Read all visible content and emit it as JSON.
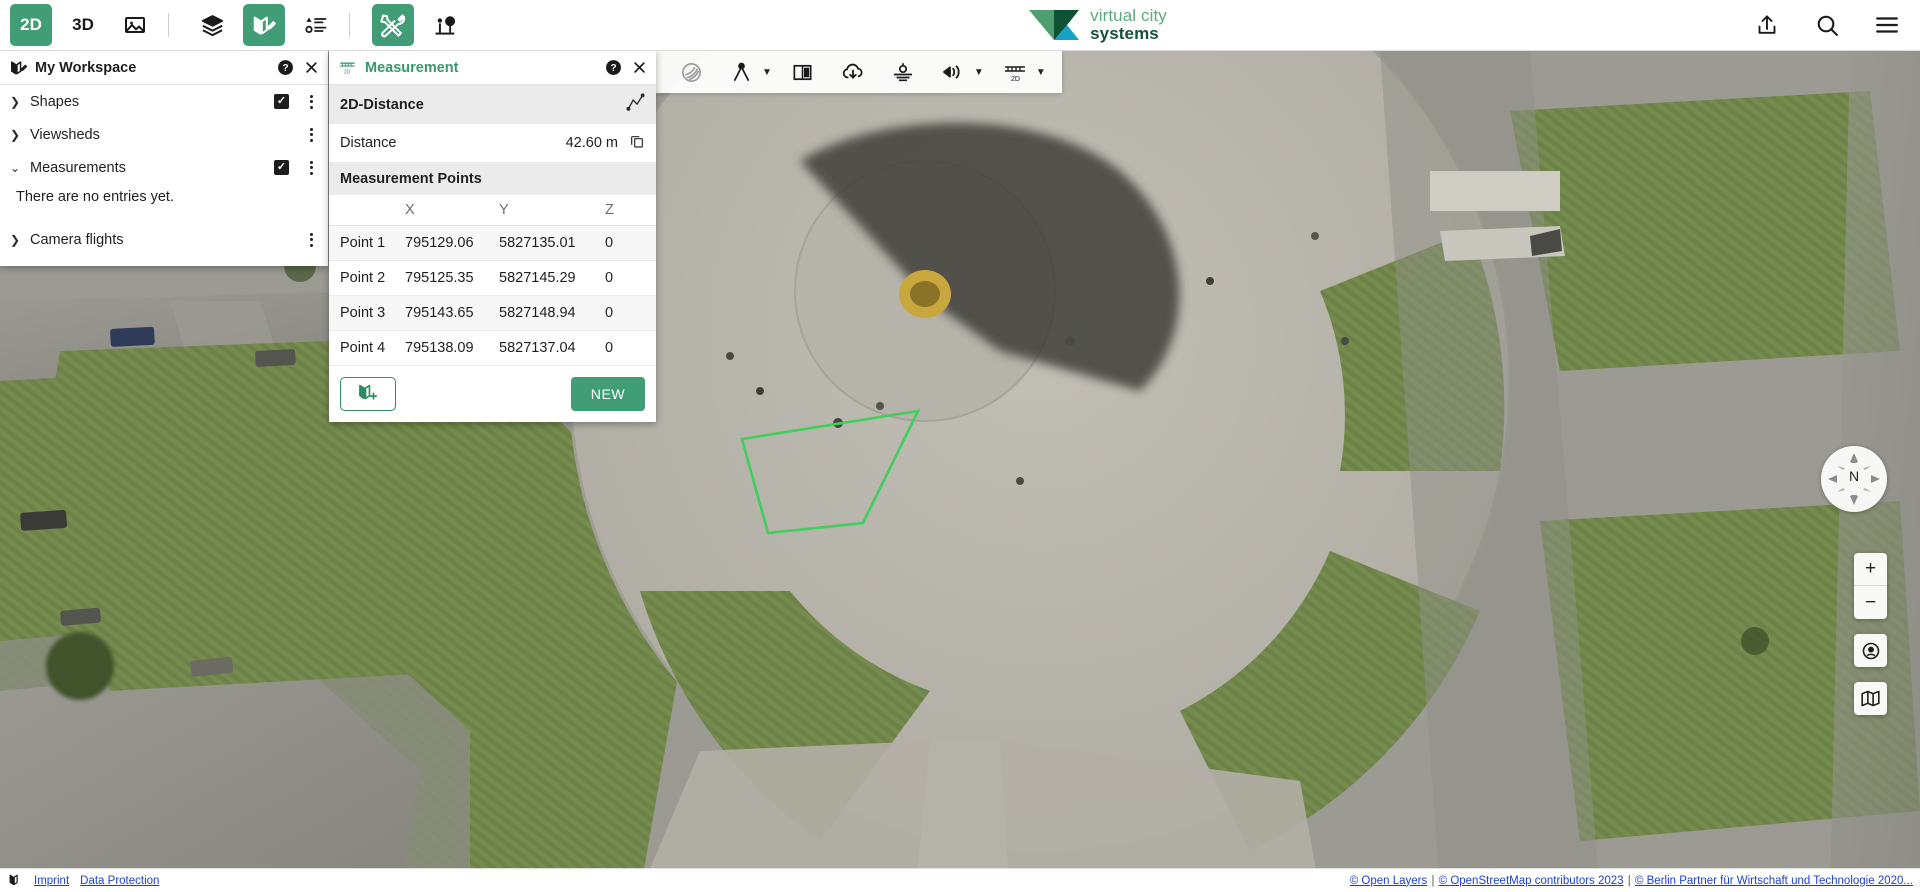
{
  "topbar": {
    "mode_2d": "2D",
    "mode_3d": "3D",
    "icons": {
      "image": "image-icon",
      "layers": "layers-icon",
      "workspace": "workspace-map-icon",
      "legend": "legend-icon",
      "tools": "tools-icon",
      "plantings": "tree-person-icon",
      "share": "share-icon",
      "search": "search-icon",
      "menu": "hamburger-menu-icon"
    },
    "logo": {
      "line1": "virtual city",
      "line2": "systems"
    }
  },
  "workspace": {
    "title": "My Workspace",
    "help_icon": "help-icon",
    "close_icon": "close-icon",
    "items": [
      {
        "label": "Shapes",
        "expanded": false,
        "checked": true
      },
      {
        "label": "Viewsheds",
        "expanded": false,
        "checked": false
      },
      {
        "label": "Measurements",
        "expanded": true,
        "checked": true
      }
    ],
    "empty_text": "There are no entries yet.",
    "camera_flights": {
      "label": "Camera flights",
      "expanded": false,
      "checked": false
    }
  },
  "measurement": {
    "title": "Measurement",
    "title_icon": "ruler-2d-icon",
    "help_icon": "help-icon",
    "close_icon": "close-icon",
    "section_mode": "2D-Distance",
    "mode_icon": "polyline-icon",
    "distance_label": "Distance",
    "distance_value": "42.60 m",
    "copy_icon": "copy-icon",
    "points_header": "Measurement Points",
    "columns": [
      "",
      "X",
      "Y",
      "Z"
    ],
    "points": [
      {
        "name": "Point 1",
        "x": "795129.06",
        "y": "5827135.01",
        "z": "0"
      },
      {
        "name": "Point 2",
        "x": "795125.35",
        "y": "5827145.29",
        "z": "0"
      },
      {
        "name": "Point 3",
        "x": "795143.65",
        "y": "5827148.94",
        "z": "0"
      },
      {
        "name": "Point 4",
        "x": "795138.09",
        "y": "5827137.04",
        "z": "0"
      }
    ],
    "add_to_workspace_icon": "add-to-workspace-icon",
    "new_button": "NEW"
  },
  "map_toolbar": {
    "icons": {
      "hide": "no-shadow-icon",
      "measure": "measurement-tool-icon",
      "measure_caret": "chevron-down-icon",
      "split": "split-view-icon",
      "export": "cloud-download-icon",
      "flight": "camera-flight-icon",
      "viewshed": "viewshed-icon",
      "viewshed_caret": "chevron-down-icon",
      "distance": "distance-2d-icon",
      "distance_caret": "chevron-down-icon"
    }
  },
  "map_controls": {
    "compass_north": "N",
    "compass_icon": "compass-icon",
    "zoom_in": "+",
    "zoom_out": "−",
    "locate_icon": "locate-icon",
    "overview_icon": "overview-map-icon"
  },
  "footer": {
    "logo_icon": "vc-map-logo-icon",
    "imprint": "Imprint",
    "data_protection": "Data Protection",
    "attribution": [
      "© Open Layers",
      "© OpenStreetMap contributors 2023",
      "© Berlin Partner für Wirtschaft und Technologie 2020..."
    ]
  },
  "colors": {
    "accent": "#409d76",
    "accent_dark": "#13533a",
    "link": "#1d3fd1",
    "measure_line": "#3fcf5c"
  }
}
